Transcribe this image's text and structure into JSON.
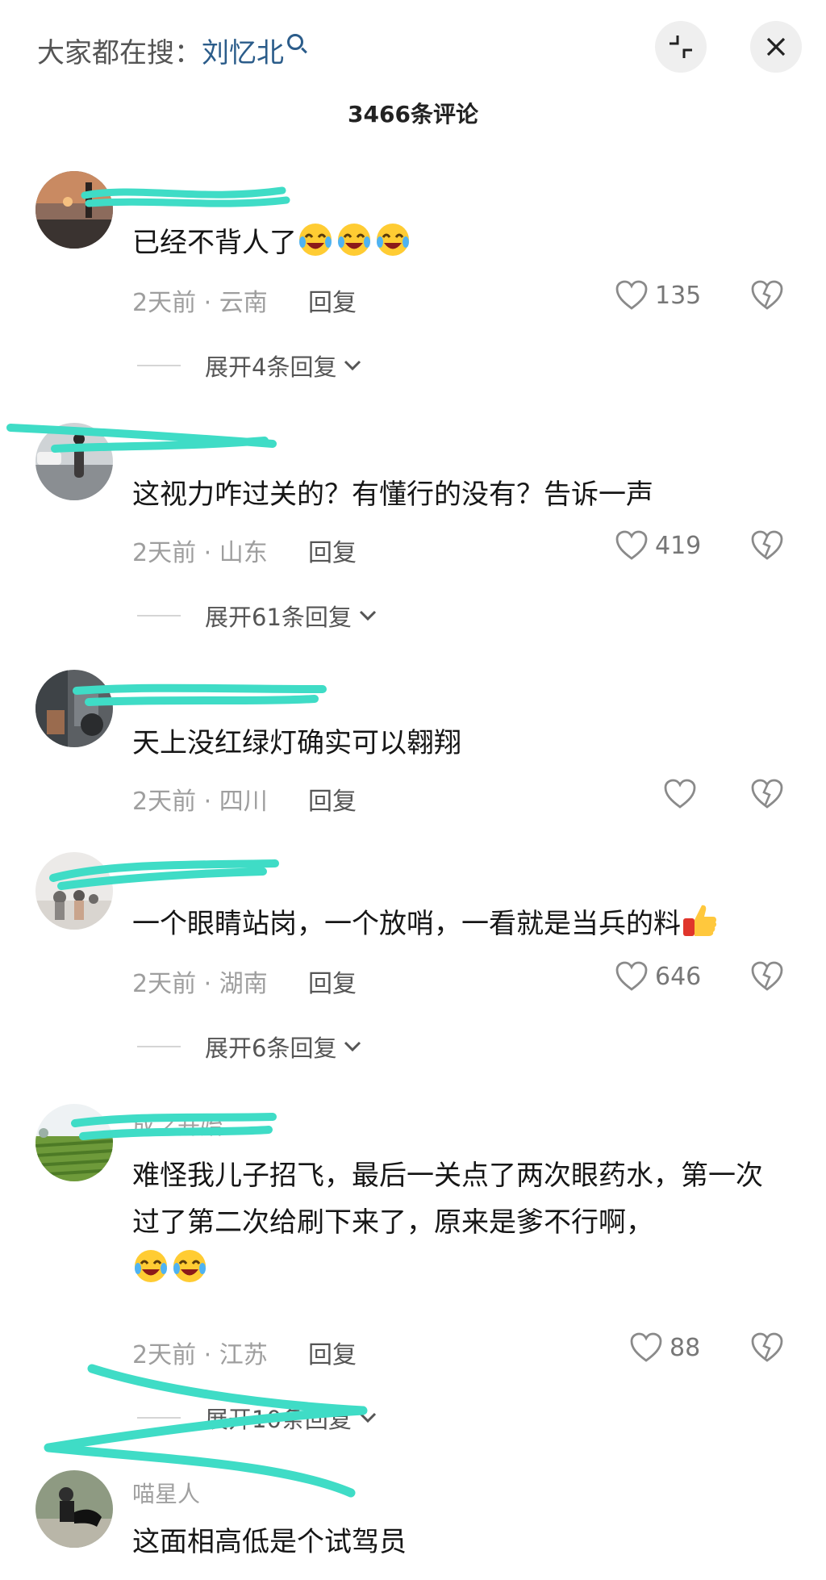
{
  "header": {
    "search_prefix": "大家都在搜：",
    "search_keyword": "刘忆北",
    "comment_count": "3466条评论"
  },
  "comments": [
    {
      "text": "已经不背人了",
      "emojis": 3,
      "time": "2天前",
      "location": "云南",
      "reply": "回复",
      "likes": "135",
      "expand": "展开4条回复"
    },
    {
      "text": "这视力咋过关的？有懂行的没有？告诉一声",
      "time": "2天前",
      "location": "山东",
      "reply": "回复",
      "likes": "419",
      "expand": "展开61条回复"
    },
    {
      "text": "天上没红绿灯确实可以翱翔",
      "time": "2天前",
      "location": "四川",
      "reply": "回复",
      "likes": ""
    },
    {
      "text": "一个眼睛站岗，一个放哨，一看就是当兵的料",
      "time": "2天前",
      "location": "湖南",
      "reply": "回复",
      "likes": "646",
      "expand": "展开6条回复"
    },
    {
      "username": "成之开始",
      "text": "难怪我儿子招飞，最后一关点了两次眼药水，第一次过了第二次给刷下来了，原来是爹不行啊，",
      "emojis": 2,
      "time": "2天前",
      "location": "江苏",
      "reply": "回复",
      "likes": "88",
      "expand": "展开10条回复"
    },
    {
      "username": "喵星人",
      "text": "这面相高低是个试驾员"
    }
  ],
  "colors": {
    "scribble": "#3fdcc6",
    "link": "#2b5c8a",
    "meta": "#9e9e9e"
  },
  "icons": [
    "search-icon",
    "collapse-icon",
    "close-icon",
    "heart-icon",
    "broken-heart-icon",
    "chevron-down-icon",
    "laugh-cry-emoji",
    "thumbs-up-emoji"
  ]
}
